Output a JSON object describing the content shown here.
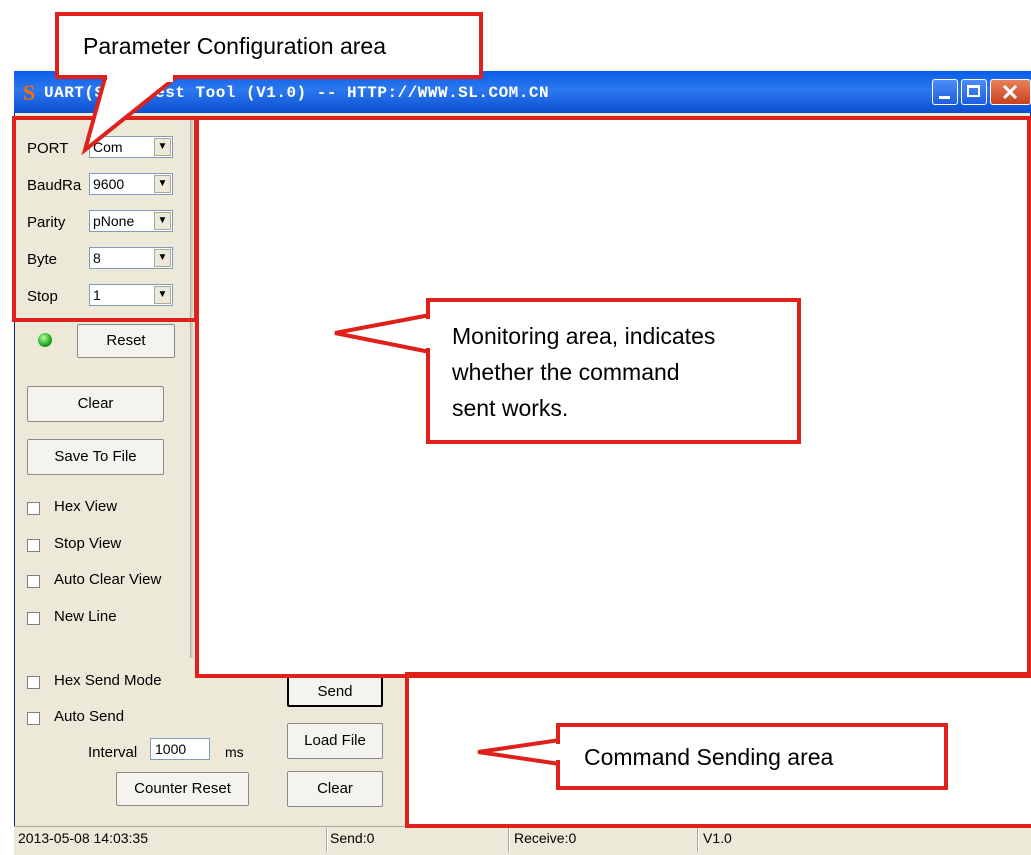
{
  "window": {
    "title": "UART(S      t) Test Tool (V1.0) -- HTTP://WWW.SL.COM.CN",
    "app_icon": "S"
  },
  "params": {
    "port_label": "PORT",
    "port_value": "Com",
    "baud_label": "BaudRa",
    "baud_value": "9600",
    "parity_label": "Parity",
    "parity_value": "pNone",
    "byte_label": "Byte",
    "byte_value": "8",
    "stop_label": "Stop",
    "stop_value": "1"
  },
  "buttons": {
    "reset": "Reset",
    "clear": "Clear",
    "save_to_file": "Save To File",
    "send": "Send",
    "load_file": "Load File",
    "clear_send": "Clear",
    "counter_reset": "Counter Reset"
  },
  "checkboxes": {
    "hex_view": "Hex View",
    "stop_view": "Stop View",
    "auto_clear_view": "Auto Clear View",
    "new_line": "New Line",
    "hex_send_mode": "Hex Send Mode",
    "auto_send": "Auto Send"
  },
  "interval": {
    "label": "Interval",
    "value": "1000",
    "unit": "ms"
  },
  "status": {
    "datetime": "2013-05-08 14:03:35",
    "send": "Send:0",
    "receive": "Receive:0",
    "version": "V1.0"
  },
  "annotations": {
    "param_config": "Parameter Configuration area",
    "monitoring_line1": "Monitoring area, indicates",
    "monitoring_line2": "whether the command",
    "monitoring_line3": "sent works.",
    "command_sending": "Command Sending area"
  },
  "colors": {
    "annotation_red": "#e0201a",
    "title_blue": "#0a5fe8",
    "led_green": "#1ea51e"
  }
}
